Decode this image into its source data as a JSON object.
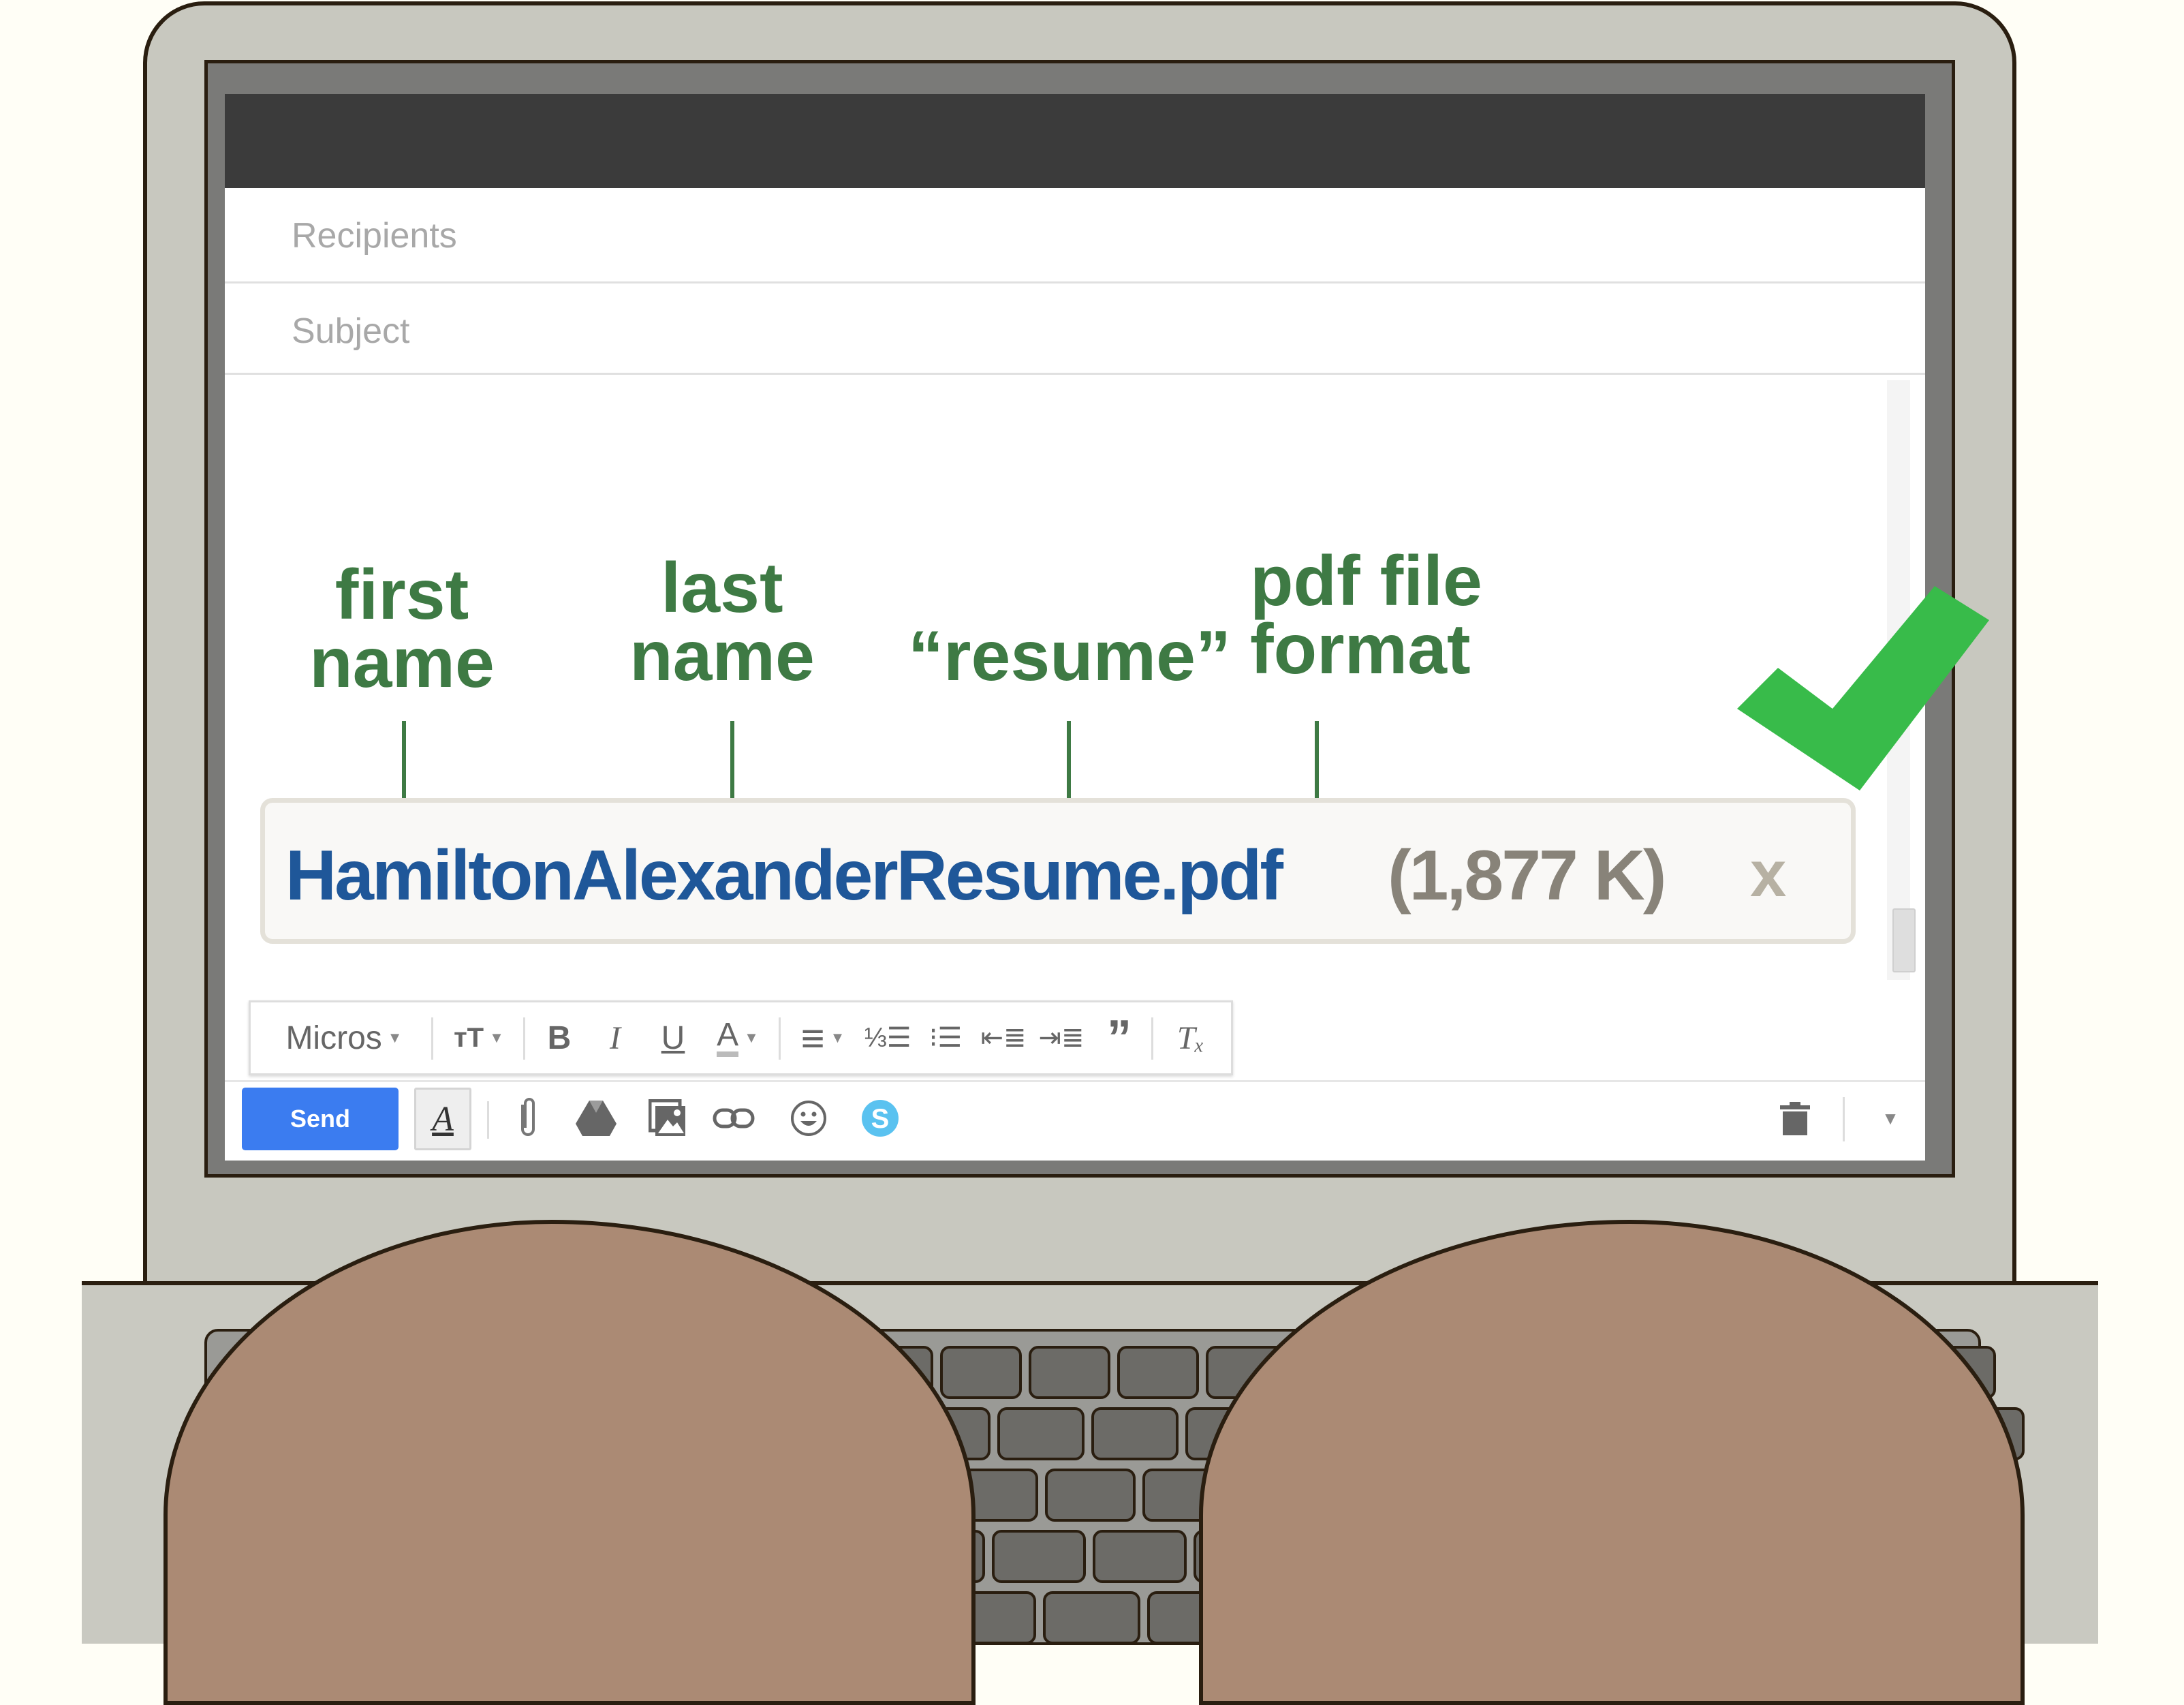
{
  "compose": {
    "recipients_placeholder": "Recipients",
    "subject_placeholder": "Subject"
  },
  "annotations": [
    {
      "line1": "first",
      "line2": "name"
    },
    {
      "line1": "last",
      "line2": "name"
    },
    {
      "line1": "",
      "line2": "“resume”"
    },
    {
      "line1": "pdf file",
      "line2": "format"
    }
  ],
  "attachment": {
    "filename": "HamiltonAlexanderResume.pdf",
    "size": "(1,877 K)",
    "remove_label": "x"
  },
  "format_toolbar": {
    "font": "Micros",
    "items": [
      {
        "icon": "text-size-icon",
        "glyph": "ᴛT"
      },
      {
        "icon": "bold-icon",
        "glyph": "B"
      },
      {
        "icon": "italic-icon",
        "glyph": "I"
      },
      {
        "icon": "underline-icon",
        "glyph": "U"
      },
      {
        "icon": "text-color-icon",
        "glyph": "A"
      },
      {
        "icon": "align-icon",
        "glyph": "≡"
      },
      {
        "icon": "numbered-list-icon",
        "glyph": "☰"
      },
      {
        "icon": "bulleted-list-icon",
        "glyph": "☰"
      },
      {
        "icon": "indent-less-icon",
        "glyph": "⇤"
      },
      {
        "icon": "indent-more-icon",
        "glyph": "⇥"
      },
      {
        "icon": "quote-icon",
        "glyph": "”"
      },
      {
        "icon": "remove-formatting-icon",
        "glyph": "Tₓ"
      }
    ]
  },
  "bottom_bar": {
    "send_label": "Send",
    "format_label": "A",
    "icons": [
      "attach-icon",
      "drive-icon",
      "photo-icon",
      "link-icon",
      "emoji-icon",
      "skype-icon",
      "trash-icon",
      "more-options-icon"
    ]
  },
  "colors": {
    "annotation_green": "#3e7a44",
    "filename_blue": "#1f5799",
    "send_blue": "#3b7cf0",
    "check_green": "#38bb4a",
    "skype_blue": "#5ac2f0"
  }
}
